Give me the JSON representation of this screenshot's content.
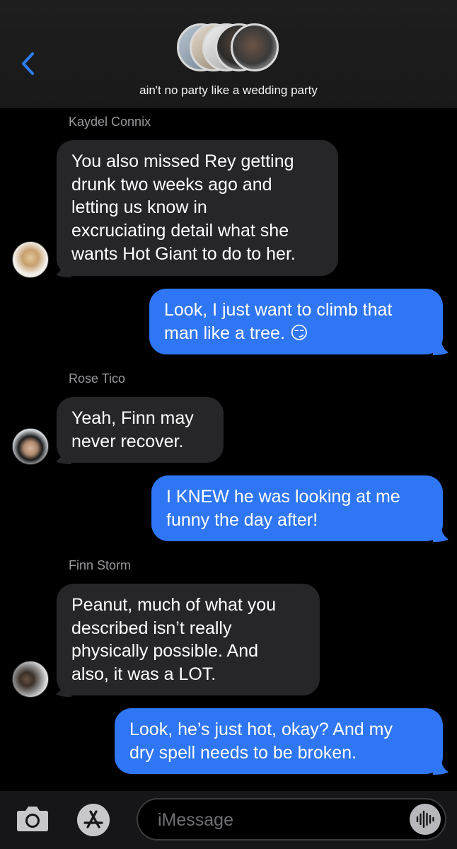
{
  "header": {
    "group_name": "ain't no party like a wedding party",
    "back_icon": "chevron-left-icon",
    "accent": "#2f76f4"
  },
  "messages": [
    {
      "sender": "Kaydel Connix",
      "direction": "in",
      "lines": [
        "You also missed Rey getting",
        "drunk two weeks ago and",
        "letting us know in",
        "excruciating detail what she",
        "wants Hot Giant to do to her."
      ]
    },
    {
      "direction": "out",
      "lines": [
        "Look, I just want to climb that",
        "man like a tree. 😏"
      ]
    },
    {
      "sender": "Rose Tico",
      "direction": "in",
      "lines": [
        "Yeah, Finn may",
        "never recover."
      ]
    },
    {
      "direction": "out",
      "lines": [
        "I KNEW he was looking at me",
        "funny the day after!"
      ]
    },
    {
      "sender": "Finn Storm",
      "direction": "in",
      "lines": [
        "Peanut, much of what you",
        "described isn’t really",
        "physically possible. And",
        "also, it was a LOT."
      ]
    },
    {
      "direction": "out",
      "lines": [
        "Look, he’s just hot, okay? And my",
        "dry spell needs to be broken."
      ]
    }
  ],
  "composer": {
    "placeholder": "iMessage",
    "camera_icon": "camera-icon",
    "apps_icon": "app-store-icon",
    "audio_icon": "audio-waveform-icon"
  },
  "colors": {
    "incoming_bubble": "#262628",
    "outgoing_bubble": "#2f76f4",
    "sender_name": "#9a9a9e"
  }
}
